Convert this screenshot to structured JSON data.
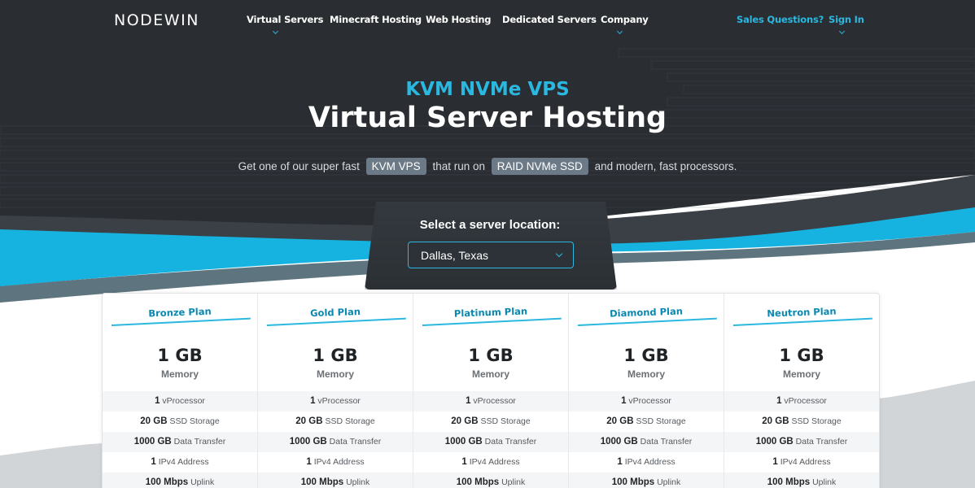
{
  "header": {
    "logo": "NODEWIN",
    "nav": [
      {
        "label": "Virtual Servers",
        "has_dropdown": true
      },
      {
        "label": "Minecraft Hosting",
        "has_dropdown": false
      },
      {
        "label": "Web Hosting",
        "has_dropdown": false
      },
      {
        "label": "Dedicated Servers",
        "has_dropdown": false
      },
      {
        "label": "Company",
        "has_dropdown": true
      }
    ],
    "sales": "Sales Questions?",
    "signin": "Sign In"
  },
  "hero": {
    "subtitle": "KVM NVMe VPS",
    "title": "Virtual Server Hosting",
    "desc_part1": "Get one of our super fast",
    "pill1": "KVM VPS",
    "desc_part2": "that run on",
    "pill2": "RAID NVMe SSD",
    "desc_part3": "and modern, fast processors."
  },
  "location": {
    "label": "Select a server location:",
    "selected": "Dallas, Texas"
  },
  "plans": [
    {
      "name": "Bronze Plan",
      "memory": "1 GB",
      "memory_label": "Memory",
      "specs": [
        [
          "1",
          "vProcessor"
        ],
        [
          "20 GB",
          "SSD Storage"
        ],
        [
          "1000 GB",
          "Data Transfer"
        ],
        [
          "1",
          "IPv4 Address"
        ],
        [
          "100 Mbps",
          "Uplink"
        ]
      ]
    },
    {
      "name": "Gold Plan",
      "memory": "1 GB",
      "memory_label": "Memory",
      "specs": [
        [
          "1",
          "vProcessor"
        ],
        [
          "20 GB",
          "SSD Storage"
        ],
        [
          "1000 GB",
          "Data Transfer"
        ],
        [
          "1",
          "IPv4 Address"
        ],
        [
          "100 Mbps",
          "Uplink"
        ]
      ]
    },
    {
      "name": "Platinum Plan",
      "memory": "1 GB",
      "memory_label": "Memory",
      "specs": [
        [
          "1",
          "vProcessor"
        ],
        [
          "20 GB",
          "SSD Storage"
        ],
        [
          "1000 GB",
          "Data Transfer"
        ],
        [
          "1",
          "IPv4 Address"
        ],
        [
          "100 Mbps",
          "Uplink"
        ]
      ]
    },
    {
      "name": "Diamond Plan",
      "memory": "1 GB",
      "memory_label": "Memory",
      "specs": [
        [
          "1",
          "vProcessor"
        ],
        [
          "20 GB",
          "SSD Storage"
        ],
        [
          "1000 GB",
          "Data Transfer"
        ],
        [
          "1",
          "IPv4 Address"
        ],
        [
          "100 Mbps",
          "Uplink"
        ]
      ]
    },
    {
      "name": "Neutron Plan",
      "memory": "1 GB",
      "memory_label": "Memory",
      "specs": [
        [
          "1",
          "vProcessor"
        ],
        [
          "20 GB",
          "SSD Storage"
        ],
        [
          "1000 GB",
          "Data Transfer"
        ],
        [
          "1",
          "IPv4 Address"
        ],
        [
          "100 Mbps",
          "Uplink"
        ]
      ]
    }
  ],
  "colors": {
    "accent": "#2bb8e0",
    "dark_bg": "#2a2d31",
    "pill_bg": "#6c7a88"
  }
}
